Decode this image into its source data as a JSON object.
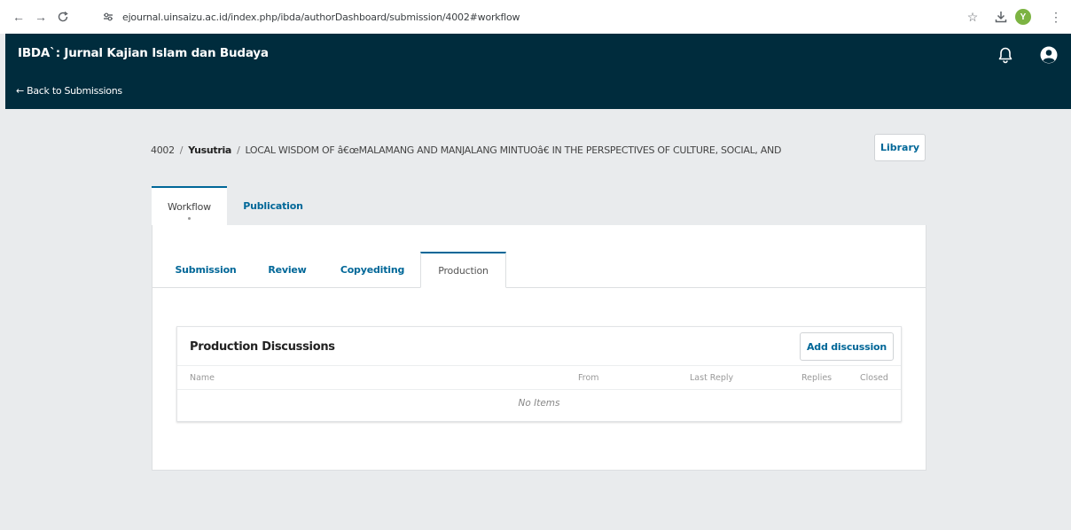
{
  "browser": {
    "url": "ejournal.uinsaizu.ac.id/index.php/ibda/authorDashboard/submission/4002#workflow",
    "profile_initial": "Y"
  },
  "header": {
    "journal_title": "IBDA`: Jurnal Kajian Islam dan Budaya",
    "back_link": "← Back to Submissions"
  },
  "submission": {
    "id": "4002",
    "author": "Yusutria",
    "title": "LOCAL WISDOM OF â€œMALAMANG AND MANJALANG MINTUOâ€ IN THE PERSPECTIVES OF CULTURE, SOCIAL, AND",
    "separator": "/",
    "library_label": "Library"
  },
  "tabs": {
    "workflow": "Workflow",
    "publication": "Publication"
  },
  "subtabs": {
    "submission": "Submission",
    "review": "Review",
    "copyediting": "Copyediting",
    "production": "Production"
  },
  "discussions": {
    "title": "Production Discussions",
    "add_label": "Add discussion",
    "columns": [
      "Name",
      "From",
      "Last Reply",
      "Replies",
      "Closed"
    ],
    "empty_text": "No Items"
  },
  "colors": {
    "header_bg": "#002c3d",
    "accent": "#006798",
    "page_bg": "#e9ebed"
  }
}
